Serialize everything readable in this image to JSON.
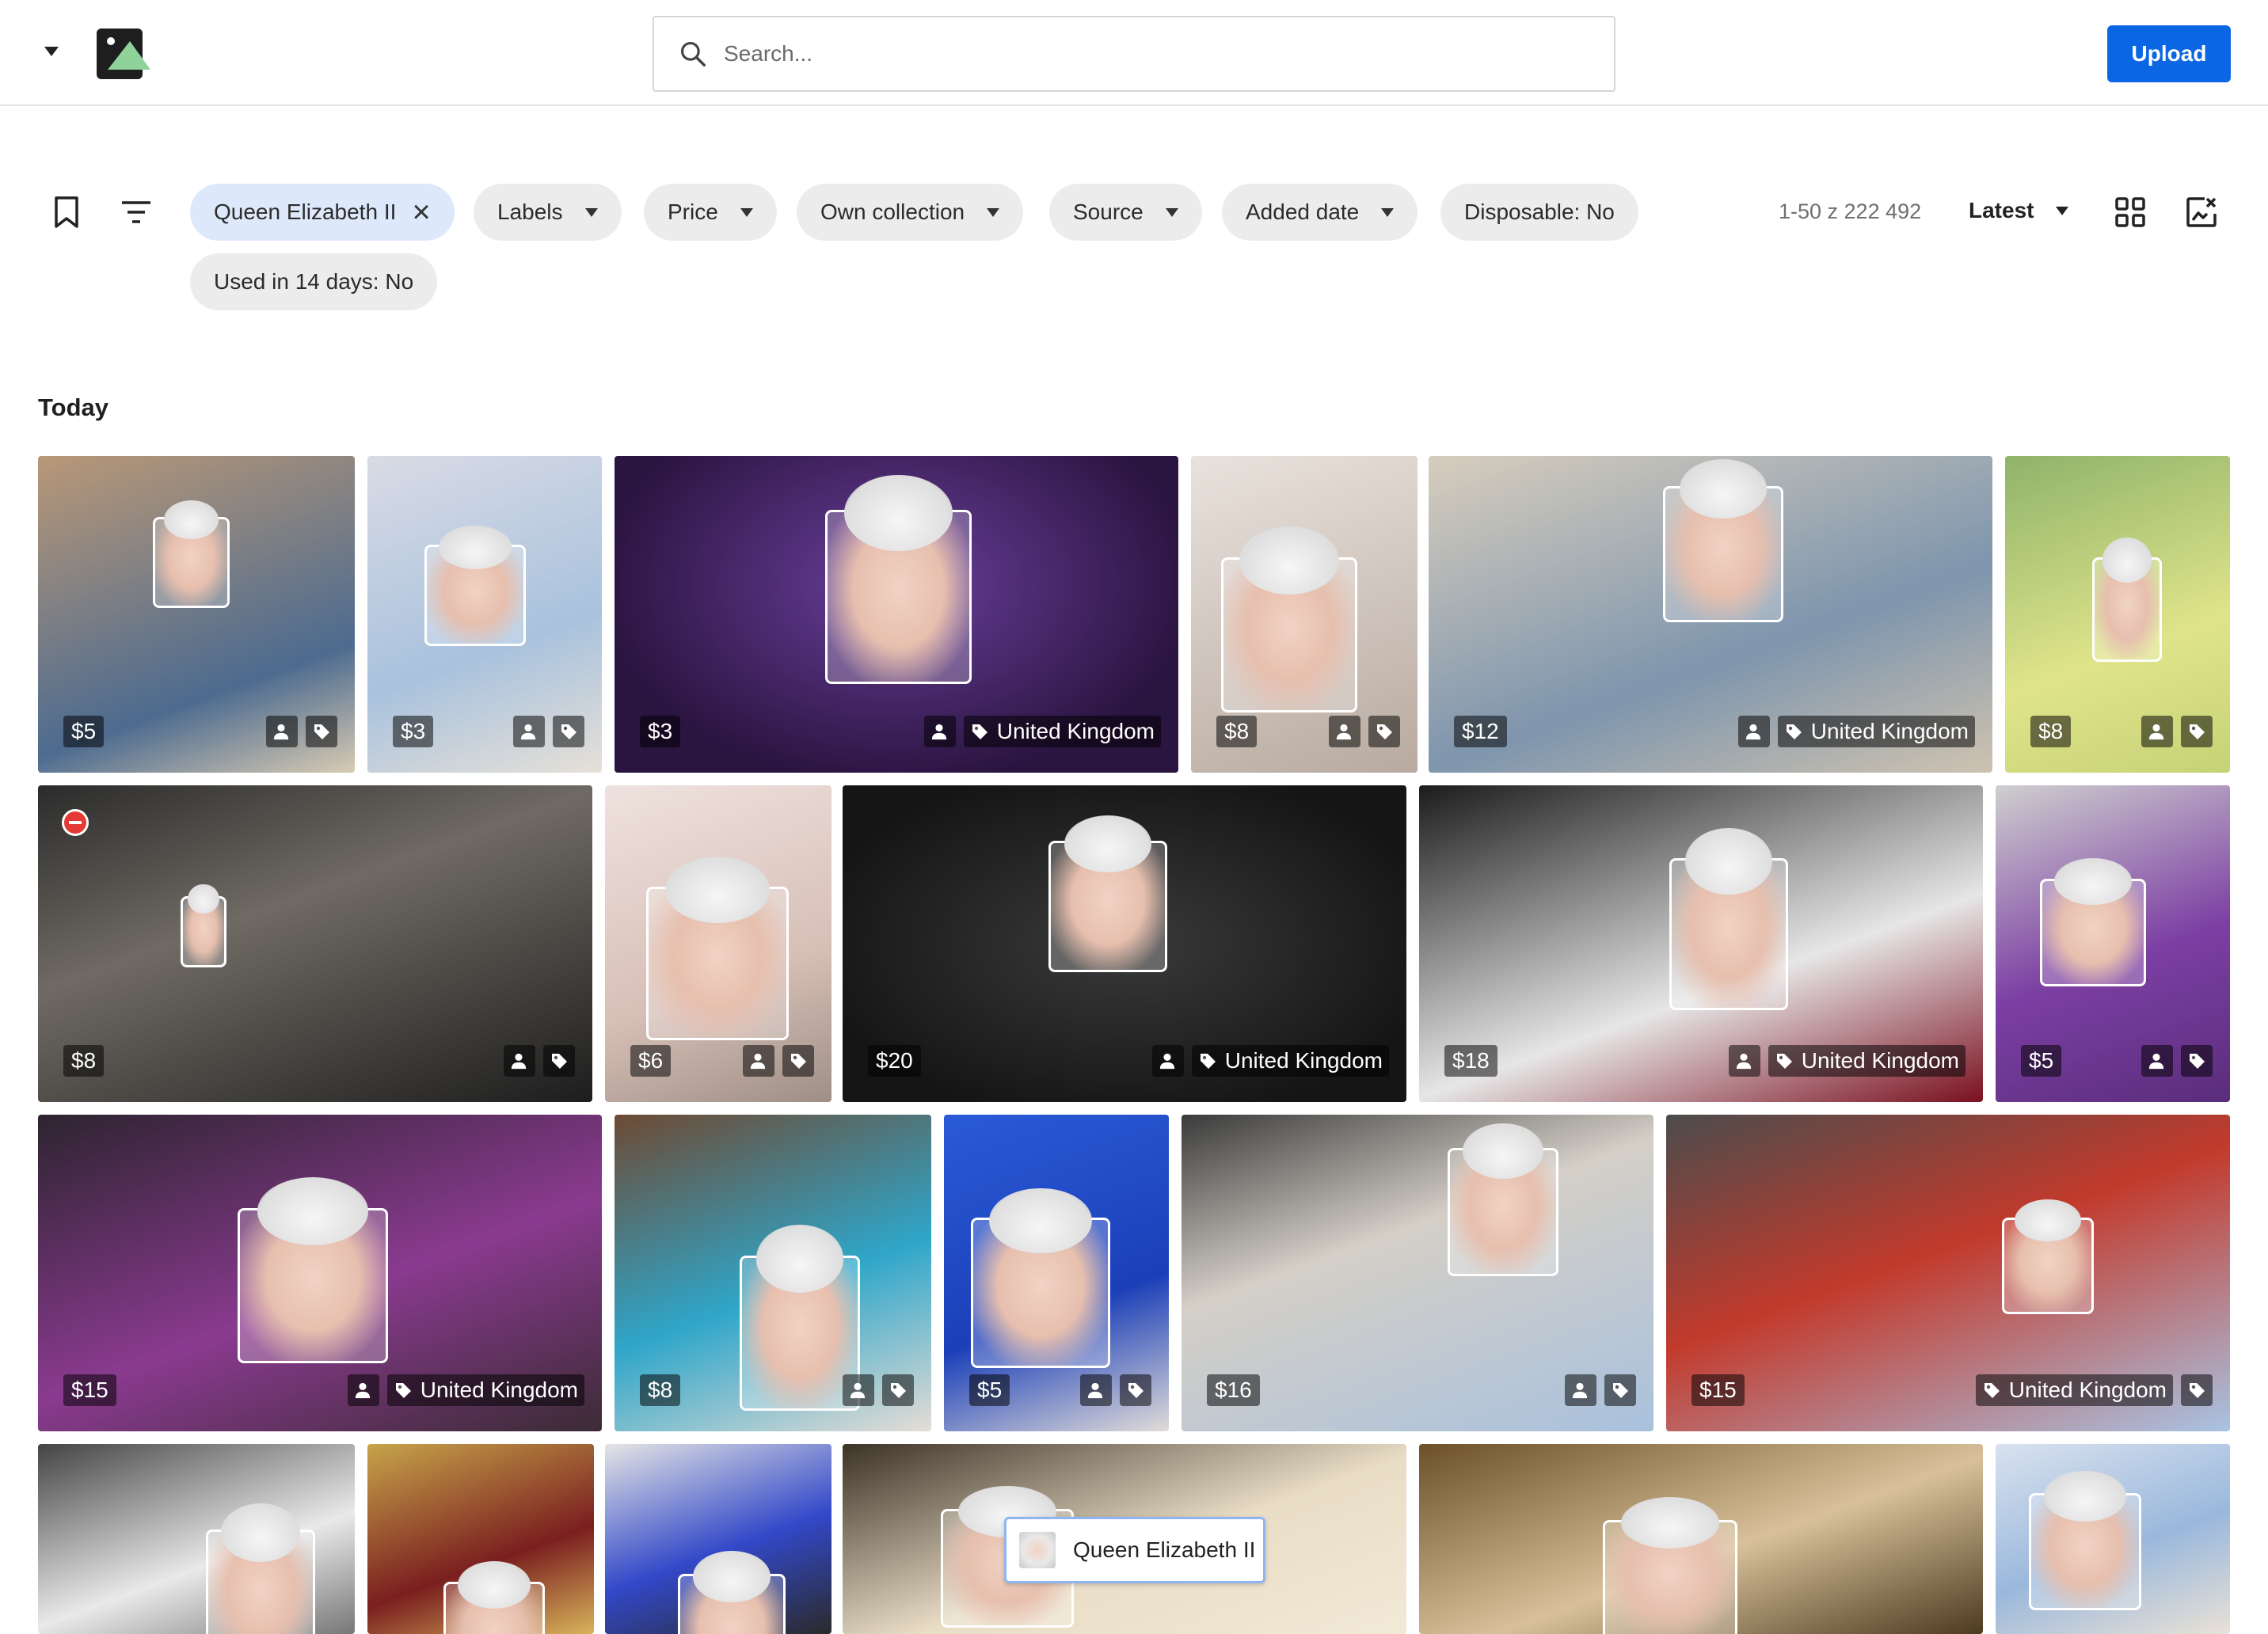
{
  "header": {
    "search_placeholder": "Search...",
    "upload_label": "Upload"
  },
  "filters": {
    "chips": [
      {
        "label": "Queen Elizabeth II",
        "active": true,
        "removable": true
      },
      {
        "label": "Labels",
        "dropdown": true
      },
      {
        "label": "Price",
        "dropdown": true
      },
      {
        "label": "Own collection",
        "dropdown": true
      },
      {
        "label": "Source",
        "dropdown": true
      },
      {
        "label": "Added date",
        "dropdown": true
      },
      {
        "label": "Disposable: No"
      },
      {
        "label": "Used in 14 days: No"
      }
    ],
    "result_count": "1-50 z 222 492",
    "sort_label": "Latest"
  },
  "section_title": "Today",
  "photos": [
    {
      "price": "$5",
      "tag": ""
    },
    {
      "price": "$3",
      "tag": ""
    },
    {
      "price": "$3",
      "tag": "United Kingdom"
    },
    {
      "price": "$8",
      "tag": ""
    },
    {
      "price": "$12",
      "tag": "United Kingdom"
    },
    {
      "price": "$8",
      "tag": ""
    },
    {
      "price": "$8",
      "tag": "",
      "blocked": true
    },
    {
      "price": "$6",
      "tag": ""
    },
    {
      "price": "$20",
      "tag": "United Kingdom"
    },
    {
      "price": "$18",
      "tag": "United Kingdom"
    },
    {
      "price": "$5",
      "tag": ""
    },
    {
      "price": "$15",
      "tag": "United Kingdom"
    },
    {
      "price": "$8",
      "tag": ""
    },
    {
      "price": "$5",
      "tag": ""
    },
    {
      "price": "$16",
      "tag": ""
    },
    {
      "price": "$15",
      "tag": "United Kingdom",
      "no_person_badge": true
    },
    {
      "price": "",
      "tag": ""
    },
    {
      "price": "",
      "tag": ""
    },
    {
      "price": "",
      "tag": ""
    },
    {
      "price": "",
      "tag": ""
    },
    {
      "price": "",
      "tag": ""
    },
    {
      "price": "",
      "tag": ""
    }
  ],
  "tooltip": {
    "label": "Queen Elizabeth II"
  },
  "colors": {
    "accent": "#0b66e4",
    "chip_active": "#dde9fb",
    "chip": "#ececec"
  }
}
